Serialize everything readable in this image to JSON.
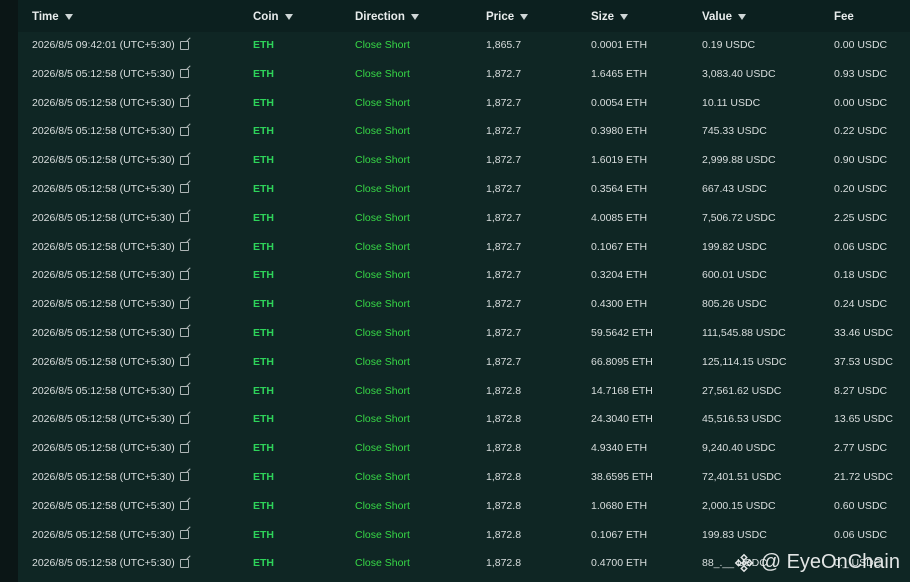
{
  "columns": {
    "time": "Time",
    "coin": "Coin",
    "direction": "Direction",
    "price": "Price",
    "size": "Size",
    "value": "Value",
    "fee": "Fee"
  },
  "rows": [
    {
      "time": "2026/8/5 09:42:01 (UTC+5:30)",
      "coin": "ETH",
      "direction": "Close Short",
      "price": "1,865.7",
      "size": "0.0001 ETH",
      "value": "0.19 USDC",
      "fee": "0.00 USDC"
    },
    {
      "time": "2026/8/5 05:12:58 (UTC+5:30)",
      "coin": "ETH",
      "direction": "Close Short",
      "price": "1,872.7",
      "size": "1.6465 ETH",
      "value": "3,083.40 USDC",
      "fee": "0.93 USDC"
    },
    {
      "time": "2026/8/5 05:12:58 (UTC+5:30)",
      "coin": "ETH",
      "direction": "Close Short",
      "price": "1,872.7",
      "size": "0.0054 ETH",
      "value": "10.11 USDC",
      "fee": "0.00 USDC"
    },
    {
      "time": "2026/8/5 05:12:58 (UTC+5:30)",
      "coin": "ETH",
      "direction": "Close Short",
      "price": "1,872.7",
      "size": "0.3980 ETH",
      "value": "745.33 USDC",
      "fee": "0.22 USDC"
    },
    {
      "time": "2026/8/5 05:12:58 (UTC+5:30)",
      "coin": "ETH",
      "direction": "Close Short",
      "price": "1,872.7",
      "size": "1.6019 ETH",
      "value": "2,999.88 USDC",
      "fee": "0.90 USDC"
    },
    {
      "time": "2026/8/5 05:12:58 (UTC+5:30)",
      "coin": "ETH",
      "direction": "Close Short",
      "price": "1,872.7",
      "size": "0.3564 ETH",
      "value": "667.43 USDC",
      "fee": "0.20 USDC"
    },
    {
      "time": "2026/8/5 05:12:58 (UTC+5:30)",
      "coin": "ETH",
      "direction": "Close Short",
      "price": "1,872.7",
      "size": "4.0085 ETH",
      "value": "7,506.72 USDC",
      "fee": "2.25 USDC"
    },
    {
      "time": "2026/8/5 05:12:58 (UTC+5:30)",
      "coin": "ETH",
      "direction": "Close Short",
      "price": "1,872.7",
      "size": "0.1067 ETH",
      "value": "199.82 USDC",
      "fee": "0.06 USDC"
    },
    {
      "time": "2026/8/5 05:12:58 (UTC+5:30)",
      "coin": "ETH",
      "direction": "Close Short",
      "price": "1,872.7",
      "size": "0.3204 ETH",
      "value": "600.01 USDC",
      "fee": "0.18 USDC"
    },
    {
      "time": "2026/8/5 05:12:58 (UTC+5:30)",
      "coin": "ETH",
      "direction": "Close Short",
      "price": "1,872.7",
      "size": "0.4300 ETH",
      "value": "805.26 USDC",
      "fee": "0.24 USDC"
    },
    {
      "time": "2026/8/5 05:12:58 (UTC+5:30)",
      "coin": "ETH",
      "direction": "Close Short",
      "price": "1,872.7",
      "size": "59.5642 ETH",
      "value": "111,545.88 USDC",
      "fee": "33.46 USDC"
    },
    {
      "time": "2026/8/5 05:12:58 (UTC+5:30)",
      "coin": "ETH",
      "direction": "Close Short",
      "price": "1,872.7",
      "size": "66.8095 ETH",
      "value": "125,114.15 USDC",
      "fee": "37.53 USDC"
    },
    {
      "time": "2026/8/5 05:12:58 (UTC+5:30)",
      "coin": "ETH",
      "direction": "Close Short",
      "price": "1,872.8",
      "size": "14.7168 ETH",
      "value": "27,561.62 USDC",
      "fee": "8.27 USDC"
    },
    {
      "time": "2026/8/5 05:12:58 (UTC+5:30)",
      "coin": "ETH",
      "direction": "Close Short",
      "price": "1,872.8",
      "size": "24.3040 ETH",
      "value": "45,516.53 USDC",
      "fee": "13.65 USDC"
    },
    {
      "time": "2026/8/5 05:12:58 (UTC+5:30)",
      "coin": "ETH",
      "direction": "Close Short",
      "price": "1,872.8",
      "size": "4.9340 ETH",
      "value": "9,240.40 USDC",
      "fee": "2.77 USDC"
    },
    {
      "time": "2026/8/5 05:12:58 (UTC+5:30)",
      "coin": "ETH",
      "direction": "Close Short",
      "price": "1,872.8",
      "size": "38.6595 ETH",
      "value": "72,401.51 USDC",
      "fee": "21.72 USDC"
    },
    {
      "time": "2026/8/5 05:12:58 (UTC+5:30)",
      "coin": "ETH",
      "direction": "Close Short",
      "price": "1,872.8",
      "size": "1.0680 ETH",
      "value": "2,000.15 USDC",
      "fee": "0.60 USDC"
    },
    {
      "time": "2026/8/5 05:12:58 (UTC+5:30)",
      "coin": "ETH",
      "direction": "Close Short",
      "price": "1,872.8",
      "size": "0.1067 ETH",
      "value": "199.83 USDC",
      "fee": "0.06 USDC"
    },
    {
      "time": "2026/8/5 05:12:58 (UTC+5:30)",
      "coin": "ETH",
      "direction": "Close Short",
      "price": "1,872.8",
      "size": "0.4700 ETH",
      "value": "88_.__ USDC",
      "fee": "0._ USDC"
    }
  ],
  "watermark": {
    "text": "@ EyeOnChain",
    "icon": "binance-logo-icon"
  },
  "icons": {
    "sort": "chevron-down-icon",
    "time_link": "external-link-icon"
  },
  "colors": {
    "background": "#0f2624",
    "header": "#0c201f",
    "coin_green": "#2ed35a",
    "direction_green": "#37d846",
    "text": "#d9dede"
  }
}
